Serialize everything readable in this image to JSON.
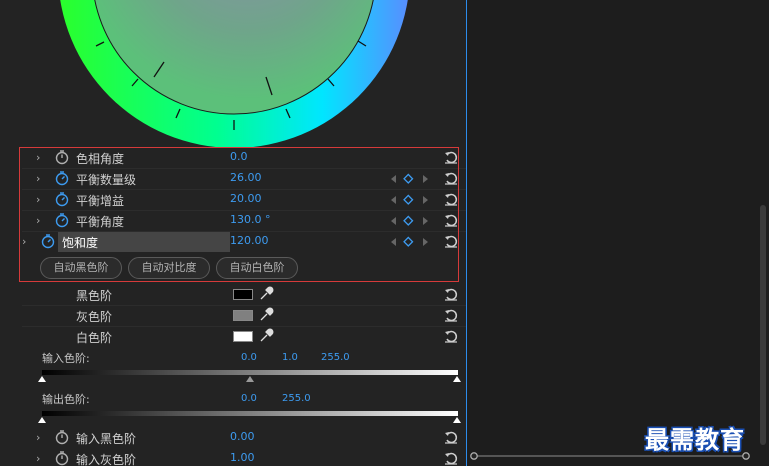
{
  "params": [
    {
      "label": "色相角度",
      "value": "0.0",
      "active": false,
      "keyframes": false
    },
    {
      "label": "平衡数量级",
      "value": "26.00",
      "active": true,
      "keyframes": true
    },
    {
      "label": "平衡增益",
      "value": "20.00",
      "active": true,
      "keyframes": true
    },
    {
      "label": "平衡角度",
      "value": "130.0 °",
      "active": true,
      "keyframes": true
    },
    {
      "label": "饱和度",
      "value": "120.00",
      "active": true,
      "keyframes": true
    }
  ],
  "auto_buttons": [
    "自动黑色阶",
    "自动对比度",
    "自动白色阶"
  ],
  "swatches": [
    {
      "label": "黑色阶",
      "color": "#000000"
    },
    {
      "label": "灰色阶",
      "color": "#808080"
    },
    {
      "label": "白色阶",
      "color": "#ffffff"
    }
  ],
  "input_levels": {
    "label": "输入色阶:",
    "black": "0.0",
    "gamma": "1.0",
    "white": "255.0"
  },
  "output_levels": {
    "label": "输出色阶:",
    "black": "0.0",
    "white": "255.0"
  },
  "bottom_params": [
    {
      "label": "输入黑色阶",
      "value": "0.00"
    },
    {
      "label": "输入灰色阶",
      "value": "1.00"
    }
  ],
  "watermark": "最需教育",
  "colors": {
    "accent": "#3d9bf0",
    "highlight_box": "#d63a3a",
    "playhead": "#2d8ceb"
  }
}
